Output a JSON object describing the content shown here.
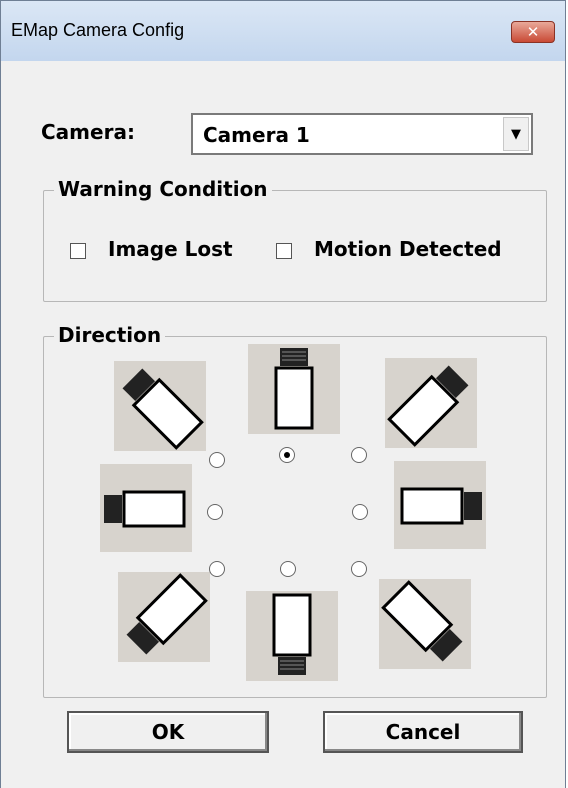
{
  "window": {
    "title": "EMap Camera Config",
    "close_symbol": "✕"
  },
  "camera": {
    "label": "Camera:",
    "selected": "Camera 1",
    "dropdown_icon": "▼"
  },
  "warning": {
    "legend": "Warning Condition",
    "image_lost_label": "Image Lost",
    "image_lost_checked": false,
    "motion_detected_label": "Motion Detected",
    "motion_detected_checked": false
  },
  "direction": {
    "legend": "Direction",
    "selected": "north",
    "options": [
      "north-west",
      "north",
      "north-east",
      "west",
      "east",
      "south-west",
      "south",
      "south-east"
    ]
  },
  "buttons": {
    "ok": "OK",
    "cancel": "Cancel"
  },
  "colors": {
    "tile_bg": "#d7d3cd",
    "dialog_bg": "#f0f0f0",
    "title_bar": "#c3d6ee",
    "close_button": "#c94a35"
  }
}
